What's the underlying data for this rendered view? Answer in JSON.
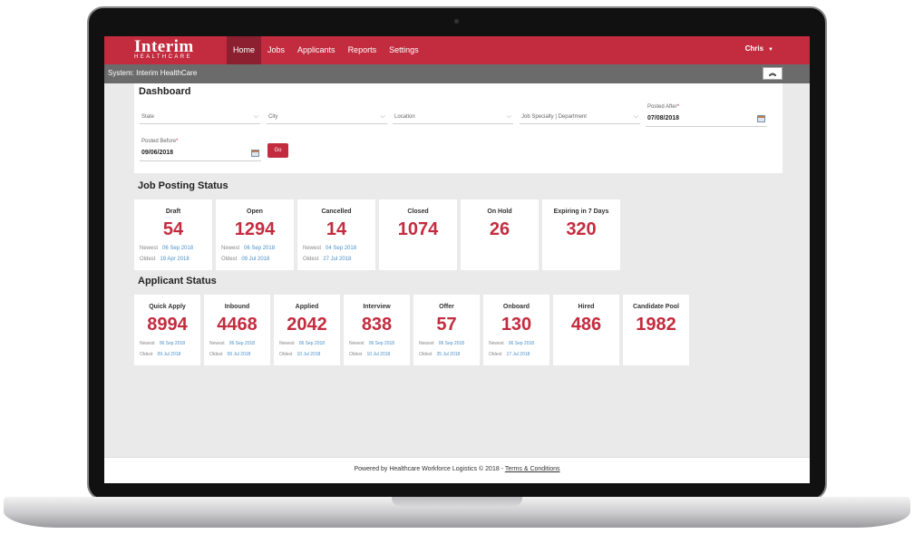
{
  "header": {
    "logo_main": "Interim",
    "logo_sub": "HEALTHCARE",
    "nav": [
      "Home",
      "Jobs",
      "Applicants",
      "Reports",
      "Settings"
    ],
    "user": "Chris"
  },
  "system_bar": {
    "label": "System: ",
    "name": "Interim HealthCare"
  },
  "dashboard": {
    "title": "Dashboard",
    "filters": {
      "state": "State",
      "city": "City",
      "location": "Location",
      "specialty": "Job Specialty | Department"
    },
    "posted_after": {
      "label": "Posted After",
      "value": "07/08/2018"
    },
    "posted_before": {
      "label": "Posted Before",
      "value": "09/06/2018"
    },
    "go": "Go"
  },
  "job_status": {
    "title": "Job Posting Status",
    "newest_label": "Newest",
    "oldest_label": "Oldest",
    "cards": [
      {
        "label": "Draft",
        "value": "54",
        "newest": "06 Sep 2018",
        "oldest": "19 Apr 2018"
      },
      {
        "label": "Open",
        "value": "1294",
        "newest": "06 Sep 2018",
        "oldest": "09 Jul 2018"
      },
      {
        "label": "Cancelled",
        "value": "14",
        "newest": "04 Sep 2018",
        "oldest": "27 Jul 2018"
      },
      {
        "label": "Closed",
        "value": "1074"
      },
      {
        "label": "On Hold",
        "value": "26"
      },
      {
        "label": "Expiring in 7 Days",
        "value": "320"
      }
    ]
  },
  "applicant_status": {
    "title": "Applicant Status",
    "newest_label": "Newest",
    "oldest_label": "Oldest",
    "cards": [
      {
        "label": "Quick Apply",
        "value": "8994",
        "newest": "06 Sep 2018",
        "oldest": "09 Jul 2018"
      },
      {
        "label": "Inbound",
        "value": "4468",
        "newest": "06 Sep 2018",
        "oldest": "09 Jul 2018"
      },
      {
        "label": "Applied",
        "value": "2042",
        "newest": "06 Sep 2018",
        "oldest": "10 Jul 2018"
      },
      {
        "label": "Interview",
        "value": "838",
        "newest": "06 Sep 2018",
        "oldest": "10 Jul 2018"
      },
      {
        "label": "Offer",
        "value": "57",
        "newest": "06 Sep 2018",
        "oldest": "25 Jul 2018"
      },
      {
        "label": "Onboard",
        "value": "130",
        "newest": "06 Sep 2018",
        "oldest": "17 Jul 2018"
      },
      {
        "label": "Hired",
        "value": "486"
      },
      {
        "label": "Candidate Pool",
        "value": "1982"
      }
    ]
  },
  "footer": {
    "text": "Powered by Healthcare Workforce Logistics © 2018 - ",
    "link": "Terms & Conditions"
  },
  "colors": {
    "brand": "#c32c3f",
    "nav_active": "#8c2030",
    "link": "#4a90c8"
  }
}
